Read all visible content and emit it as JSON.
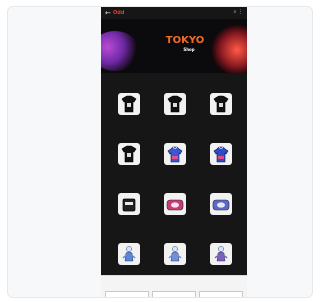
{
  "topbar": {
    "back_glyph": "←",
    "brand": "Odd",
    "icons": "⌕ ⋮"
  },
  "banner": {
    "top_text": "",
    "title": "TOKYO",
    "subtitle": "Shop"
  },
  "section": {
    "heading": "",
    "subheading": ""
  },
  "products": [
    {
      "title": "",
      "price": "",
      "thumb": "tshirt",
      "color": "#111111"
    },
    {
      "title": "",
      "price": "",
      "thumb": "tshirt",
      "color": "#111111"
    },
    {
      "title": "",
      "price": "",
      "thumb": "tshirt",
      "color": "#111111"
    },
    {
      "title": "",
      "price": "",
      "thumb": "tshirt",
      "color": "#111111"
    },
    {
      "title": "",
      "price": "",
      "thumb": "hoodie",
      "color": "#3c57d6"
    },
    {
      "title": "",
      "price": "",
      "thumb": "hoodie",
      "color": "#2c4dc9"
    },
    {
      "title": "",
      "price": "",
      "thumb": "box",
      "color": "#222222"
    },
    {
      "title": "",
      "price": "",
      "thumb": "pillow",
      "color": "#c73b77"
    },
    {
      "title": "",
      "price": "",
      "thumb": "pillow",
      "color": "#5d67c8"
    },
    {
      "title": "",
      "price": "",
      "thumb": "figure",
      "color": "#5b86d8"
    },
    {
      "title": "",
      "price": "",
      "thumb": "figure",
      "color": "#6f90d8"
    },
    {
      "title": "",
      "price": "",
      "thumb": "figure",
      "color": "#7a61b9"
    }
  ],
  "cookie": {
    "title": "",
    "text": "",
    "buttons": [
      "",
      "",
      ""
    ]
  },
  "colors": {
    "accent": "#f16b2b",
    "background": "#161616"
  }
}
